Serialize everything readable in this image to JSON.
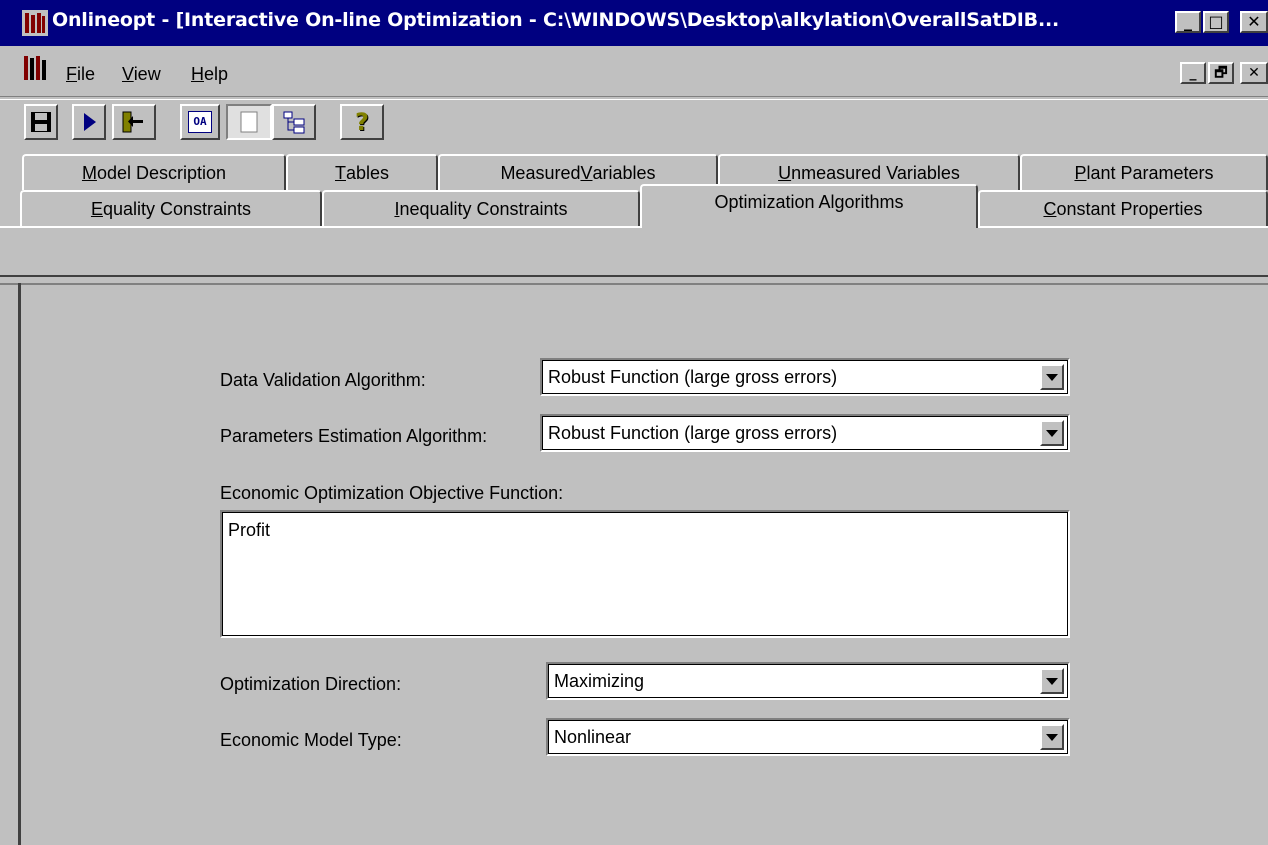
{
  "window": {
    "title": "Onlineopt - [Interactive On-line Optimization - C:\\WINDOWS\\Desktop\\alkylation\\OverallSatDIB...",
    "minimize_glyph": "_",
    "maximize_glyph": "□",
    "close_glyph": "✕"
  },
  "menu": {
    "items": [
      {
        "label": "File",
        "accel": "F",
        "rest": "ile"
      },
      {
        "label": "View",
        "accel": "V",
        "rest": "iew"
      },
      {
        "label": "Help",
        "accel": "H",
        "rest": "elp"
      }
    ],
    "mdi_minimize": "_",
    "mdi_restore": "🗗",
    "mdi_close": "✕"
  },
  "toolbar": {
    "icons": [
      "save-icon",
      "run-icon",
      "exit-icon",
      "oa-icon",
      "page-icon",
      "tree-icon",
      "help-icon"
    ],
    "oa_text": "OA",
    "help_text": "?"
  },
  "tabs": {
    "row1": [
      {
        "pre": "",
        "accel": "M",
        "post": "odel Description"
      },
      {
        "pre": "",
        "accel": "T",
        "post": "ables"
      },
      {
        "pre": "Measured ",
        "accel": "V",
        "post": "ariables"
      },
      {
        "pre": "",
        "accel": "U",
        "post": "nmeasured Variables"
      },
      {
        "pre": "",
        "accel": "P",
        "post": "lant Parameters"
      }
    ],
    "row2": [
      {
        "pre": "",
        "accel": "E",
        "post": "quality Constraints"
      },
      {
        "pre": "",
        "accel": "I",
        "post": "nequality Constraints"
      },
      {
        "pre": "Optimization Algorithms",
        "accel": "",
        "post": ""
      },
      {
        "pre": "",
        "accel": "C",
        "post": "onstant Properties"
      }
    ],
    "active": "Optimization Algorithms"
  },
  "form": {
    "data_validation": {
      "label": "Data Validation Algorithm:",
      "value": "Robust Function (large gross errors)"
    },
    "param_estimation": {
      "label": "Parameters Estimation Algorithm:",
      "value": "Robust Function (large gross errors)"
    },
    "objective": {
      "label": "Economic Optimization Objective Function:",
      "value": "Profit"
    },
    "direction": {
      "label": "Optimization Direction:",
      "value": "Maximizing"
    },
    "model_type": {
      "label": "Economic Model Type:",
      "value": "Nonlinear"
    }
  },
  "colors": {
    "titlebar": "#000080",
    "face": "#c0c0c0",
    "field": "#ffffff"
  }
}
